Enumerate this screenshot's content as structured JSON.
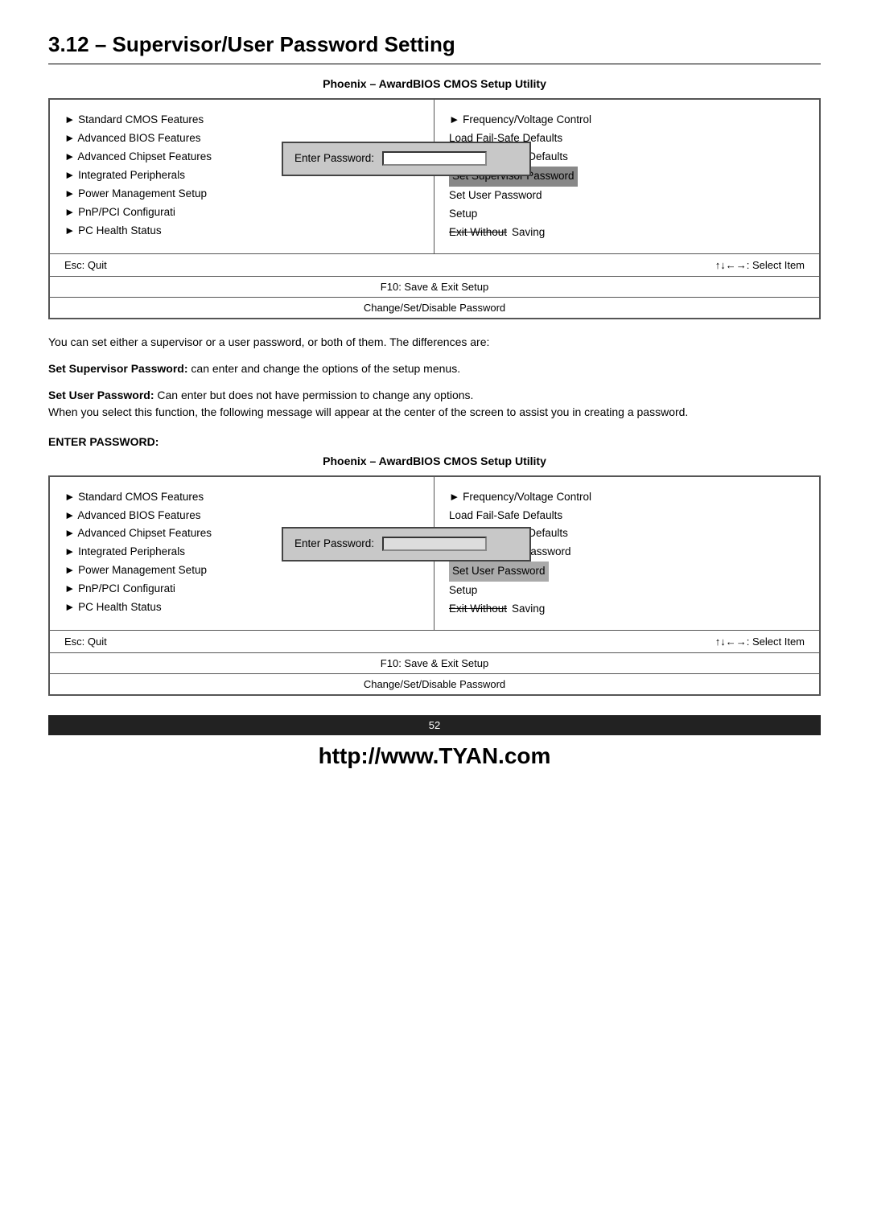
{
  "title": "3.12 – Supervisor/User Password Setting",
  "subtitle1": "Phoenix – AwardBIOS CMOS Setup Utility",
  "bios1": {
    "left_items": [
      "► Standard CMOS Features",
      "► Advanced BIOS Features",
      "► Advanced Chipset Features",
      "► Integrated Peripherals",
      "► Power Management Setup",
      "► PnP/PCI Configurati",
      "► PC Health Status"
    ],
    "right_items": [
      "► Frequency/Voltage Control",
      "Load Fail-Safe Defaults",
      "Load Optimized Defaults",
      "Set Supervisor Password",
      "Set User Password",
      "Setup",
      "Exit Without Saving"
    ],
    "highlighted_right": "Set Supervisor Password",
    "dialog_label": "Enter Password:",
    "footer_left": "Esc:  Quit",
    "footer_right": "↑↓←→: Select Item",
    "footer_center": "F10:  Save & Exit Setup",
    "footer_bottom": "Change/Set/Disable Password"
  },
  "body_text1": "You can set either a supervisor or a user password, or both of them. The differences are:",
  "body_text2_bold": "Set Supervisor Password:",
  "body_text2_rest": " can enter and change the options of the setup menus.",
  "body_text3_bold": "Set User Password:",
  "body_text3_rest": "  Can enter but does not have permission to change any options.",
  "body_text4": " When you select this function, the following message will appear at the center of the screen to assist you in creating a password.",
  "enter_password_heading": "ENTER PASSWORD:",
  "subtitle2": "Phoenix – AwardBIOS CMOS Setup Utility",
  "bios2": {
    "left_items": [
      "► Standard CMOS Features",
      "► Advanced BIOS Features",
      "► Advanced Chipset Features",
      "► Integrated Peripherals",
      "► Power Management Setup",
      "► PnP/PCI Configurati",
      "► PC Health Status"
    ],
    "right_items": [
      "► Frequency/Voltage Control",
      "Load Fail-Safe Defaults",
      "Load Optimized Defaults",
      "Set Supervisor Password",
      "Set User Password",
      "Setup",
      "Exit Without Saving"
    ],
    "highlighted_right": "Set User Password",
    "dialog_label": "Enter Password:",
    "footer_left": "Esc:  Quit",
    "footer_right": "↑↓←→: Select Item",
    "footer_center": "F10:  Save & Exit Setup",
    "footer_bottom": "Change/Set/Disable Password"
  },
  "page_number": "52",
  "url": "http://www.TYAN.com"
}
